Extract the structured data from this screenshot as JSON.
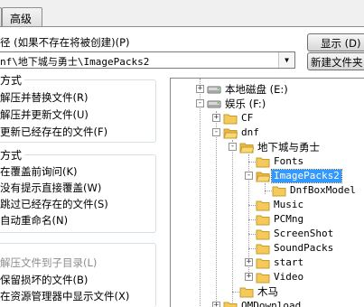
{
  "tabs": {
    "advanced_label": "高级"
  },
  "target": {
    "path_label": "目标路径 (如果不存在将被创建)(P)",
    "path_label_visible": "径 (如果不存在将被创建)(P)",
    "path_value": "nf\\地下城与勇士\\ImagePacks2",
    "show_button": "显示 (D)",
    "new_folder_button": "新建文件夹"
  },
  "update_mode": {
    "title": "方式",
    "options": [
      "解压并替换文件(R)",
      "解压并更新文件(U)",
      "更新已经存在的文件(F)"
    ]
  },
  "overwrite_mode": {
    "title": "方式",
    "options": [
      "在覆盖前询问(K)",
      "没有提示直接覆盖(W)",
      "跳过已经存在的文件(S)",
      "自动重命名(N)"
    ]
  },
  "misc": {
    "title": "",
    "options": [
      "解压文件到子目录(L)",
      "保留损坏的文件(B)",
      "在资源管理器中显示文件(X)"
    ]
  },
  "tree": {
    "items": [
      {
        "label": "本地磁盘 (E:)",
        "icon": "drive-icon",
        "expander": "+"
      },
      {
        "label": "娱乐 (F:)",
        "icon": "drive-icon",
        "expander": "-"
      },
      {
        "label": "CF",
        "icon": "folder-icon",
        "expander": "+"
      },
      {
        "label": "dnf",
        "icon": "folder-icon",
        "expander": "-"
      },
      {
        "label": "地下城与勇士",
        "icon": "folder-open-icon",
        "expander": "-"
      },
      {
        "label": "Fonts",
        "icon": "folder-icon",
        "expander": ""
      },
      {
        "label": "ImagePacks2",
        "icon": "folder-open-icon",
        "expander": "-",
        "selected": true
      },
      {
        "label": "DnfBoxModel",
        "icon": "folder-icon",
        "expander": ""
      },
      {
        "label": "Music",
        "icon": "folder-icon",
        "expander": ""
      },
      {
        "label": "PCMng",
        "icon": "folder-icon",
        "expander": ""
      },
      {
        "label": "ScreenShot",
        "icon": "folder-icon",
        "expander": ""
      },
      {
        "label": "SoundPacks",
        "icon": "folder-icon",
        "expander": ""
      },
      {
        "label": "start",
        "icon": "folder-icon",
        "expander": "+"
      },
      {
        "label": "Video",
        "icon": "folder-icon",
        "expander": "+"
      },
      {
        "label": "木马",
        "icon": "folder-icon",
        "expander": ""
      },
      {
        "label": "QMDownload",
        "icon": "folder-icon",
        "expander": "+"
      }
    ]
  },
  "colors": {
    "selection": "#3399ff",
    "folder": "#f4cb5a"
  }
}
